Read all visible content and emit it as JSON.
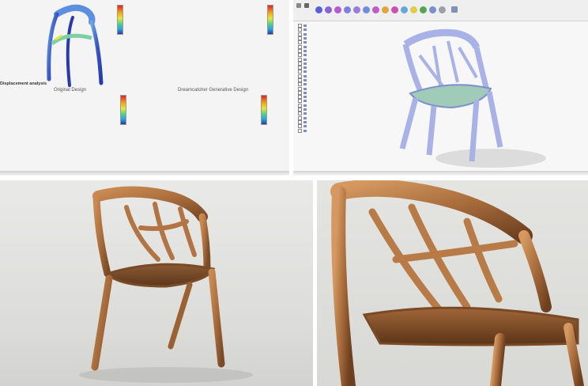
{
  "analysis_panel": {
    "section_top": "",
    "section_bottom": "Displacement analysis",
    "label_original": "Original Design",
    "label_generative": "Dreamcatcher Generative Design",
    "scale_values": [
      "",
      "",
      "",
      "",
      ""
    ],
    "colors": {
      "high": "#e02222",
      "mid": "#e6e63a",
      "low": "#2a3aa8",
      "cyan": "#2aa6df"
    }
  },
  "cad_panel": {
    "tool_icons": [
      "sketch-icon",
      "extrude-icon",
      "revolve-icon",
      "sweep-icon",
      "loft-icon",
      "fillet-icon",
      "shell-icon",
      "combine-icon",
      "move-icon",
      "align-icon",
      "measure-icon",
      "inspect-icon",
      "insert-icon",
      "render-icon"
    ],
    "tree_items": [
      "",
      "",
      "",
      "",
      "",
      "",
      "",
      "",
      "",
      "",
      "",
      "",
      "",
      "",
      "",
      "",
      "",
      "",
      "",
      "",
      "",
      "",
      "",
      "",
      "",
      ""
    ],
    "mesh_color": "#a9b2e6",
    "seat_color": "#9fcbb8"
  },
  "photos": {
    "wood_dark": "#7a4a26",
    "wood_mid": "#a86c3c",
    "wood_light": "#c98a52"
  }
}
